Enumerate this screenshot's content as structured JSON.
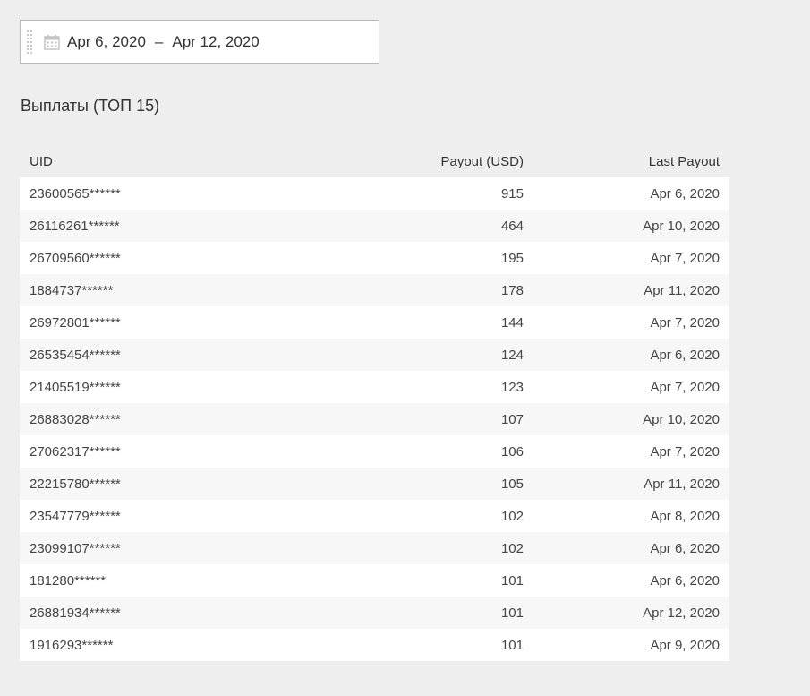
{
  "date_range": {
    "start": "Apr 6, 2020",
    "separator": "–",
    "end": "Apr 12, 2020"
  },
  "section": {
    "title": "Выплаты (ТОП 15)"
  },
  "table": {
    "headers": [
      "UID",
      "Payout (USD)",
      "Last Payout"
    ],
    "rows": [
      [
        "23600565******",
        "915",
        "Apr 6, 2020"
      ],
      [
        "26116261******",
        "464",
        "Apr 10, 2020"
      ],
      [
        "26709560******",
        "195",
        "Apr 7, 2020"
      ],
      [
        "1884737******",
        "178",
        "Apr 11, 2020"
      ],
      [
        "26972801******",
        "144",
        "Apr 7, 2020"
      ],
      [
        "26535454******",
        "124",
        "Apr 6, 2020"
      ],
      [
        "21405519******",
        "123",
        "Apr 7, 2020"
      ],
      [
        "26883028******",
        "107",
        "Apr 10, 2020"
      ],
      [
        "27062317******",
        "106",
        "Apr 7, 2020"
      ],
      [
        "22215780******",
        "105",
        "Apr 11, 2020"
      ],
      [
        "23547779******",
        "102",
        "Apr 8, 2020"
      ],
      [
        "23099107******",
        "102",
        "Apr 6, 2020"
      ],
      [
        "181280******",
        "101",
        "Apr 6, 2020"
      ],
      [
        "26881934******",
        "101",
        "Apr 12, 2020"
      ],
      [
        "1916293******",
        "101",
        "Apr 9, 2020"
      ]
    ]
  },
  "icons": {
    "drag": "drag-handle-icon",
    "calendar": "calendar-icon"
  }
}
